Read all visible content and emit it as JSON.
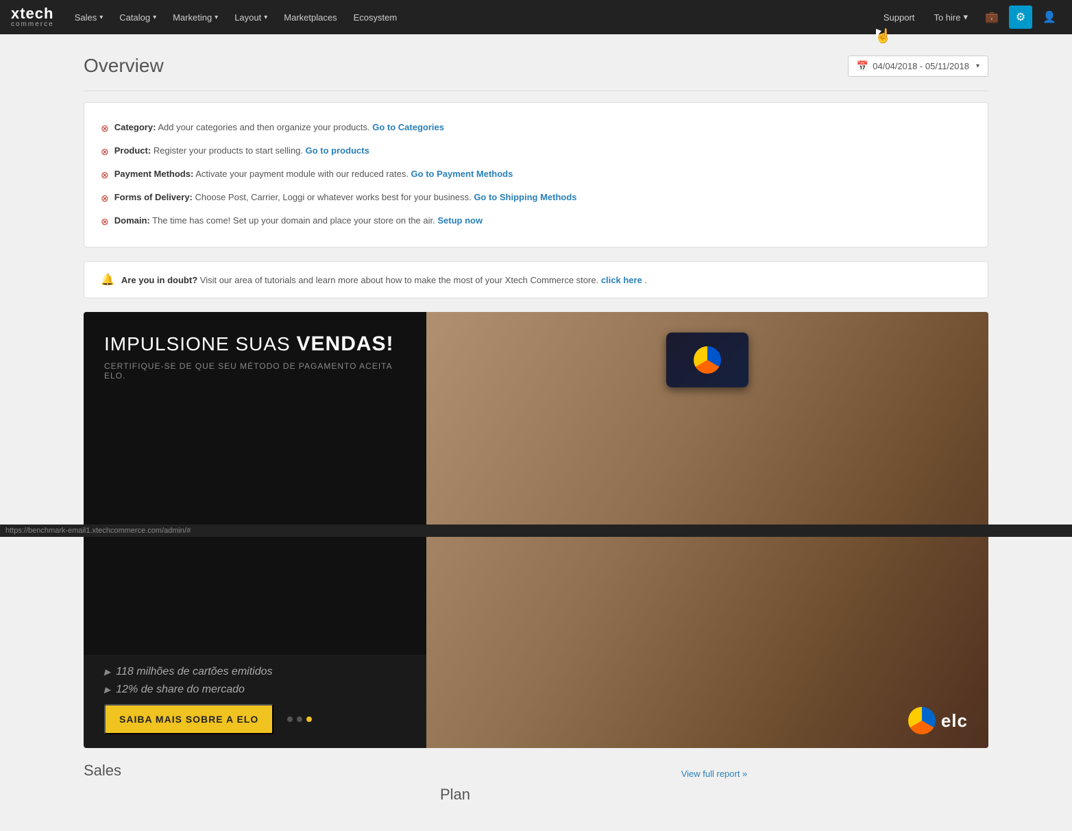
{
  "brand": {
    "name": "xtech",
    "sub": "commerce"
  },
  "navbar": {
    "items": [
      {
        "label": "Sales",
        "has_dropdown": true
      },
      {
        "label": "Catalog",
        "has_dropdown": true
      },
      {
        "label": "Marketing",
        "has_dropdown": true
      },
      {
        "label": "Layout",
        "has_dropdown": true
      },
      {
        "label": "Marketplaces",
        "has_dropdown": false
      },
      {
        "label": "Ecosystem",
        "has_dropdown": false
      }
    ],
    "right_items": [
      {
        "label": "Support"
      },
      {
        "label": "To hire",
        "has_dropdown": true
      }
    ]
  },
  "page": {
    "title": "Overview"
  },
  "date_range": {
    "value": "04/04/2018 - 05/11/2018"
  },
  "notices": [
    {
      "label": "Category:",
      "text": "Add your categories and then organize your products.",
      "action_label": "Go to Categories",
      "action_url": "#"
    },
    {
      "label": "Product:",
      "text": "Register your products to start selling.",
      "action_label": "Go to products",
      "action_url": "#"
    },
    {
      "label": "Payment Methods:",
      "text": "Activate your payment module with our reduced rates.",
      "action_label": "Go to Payment Methods",
      "action_url": "#"
    },
    {
      "label": "Forms of Delivery:",
      "text": "Choose Post, Carrier, Loggi or whatever works best for your business.",
      "action_label": "Go to Shipping Methods",
      "action_url": "#"
    },
    {
      "label": "Domain:",
      "text": "The time has come! Set up your domain and place your store on the air.",
      "action_label": "Setup now",
      "action_url": "#"
    }
  ],
  "info_banner": {
    "text_before": "Are you in doubt?",
    "text": " Visit our area of tutorials and learn more about how to make the most of your Xtech Commerce store.",
    "action_label": "click here",
    "action_url": "#"
  },
  "promo_banner": {
    "headline_normal": "IMPULSIONE SUAS ",
    "headline_bold": "VENDAS!",
    "subtitle": "CERTIFIQUE-SE DE QUE SEU MÉTODO DE PAGAMENTO ACEITA ELO.",
    "stats": [
      "118 milhões de cartões emitidos",
      "12% de share do mercado"
    ],
    "cta_label": "SAIBA MAIS SOBRE A ELO",
    "dots": [
      {
        "active": false
      },
      {
        "active": false
      },
      {
        "active": true
      }
    ]
  },
  "sales_section": {
    "title": "Sales"
  },
  "plan_section": {
    "title": "Plan"
  },
  "view_report": {
    "label": "View full report »"
  },
  "status_bar": {
    "url": "https://benchmark-email1.xtechcommerce.com/admin/#"
  }
}
